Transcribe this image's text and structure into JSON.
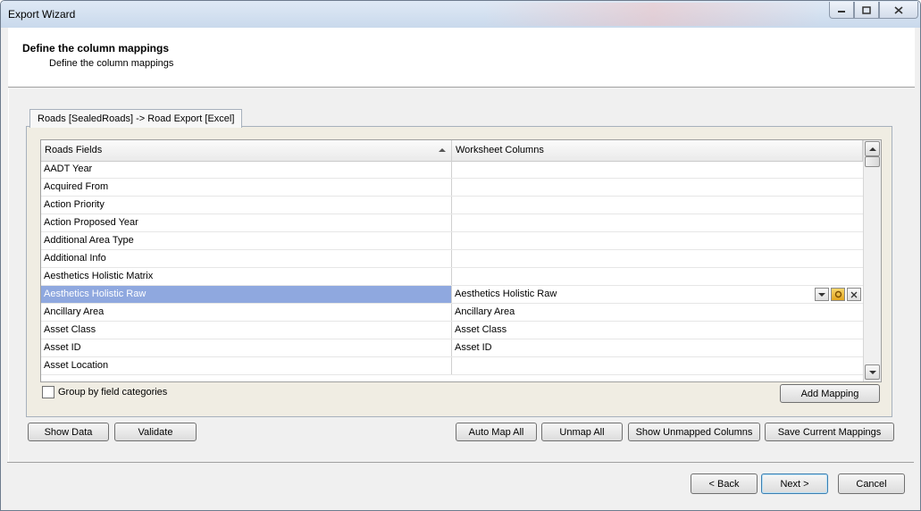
{
  "window": {
    "title": "Export Wizard",
    "controls": {
      "minimize": "—",
      "maximize": "□",
      "close": "✕"
    }
  },
  "header": {
    "title": "Define the column mappings",
    "subtitle": "Define the column mappings"
  },
  "tab": {
    "label": "Roads [SealedRoads] -> Road Export [Excel]"
  },
  "grid": {
    "columns": [
      "Roads Fields",
      "Worksheet Columns"
    ],
    "rows": [
      {
        "field": "AADT Year",
        "column": ""
      },
      {
        "field": "Acquired From",
        "column": ""
      },
      {
        "field": "Action Priority",
        "column": ""
      },
      {
        "field": "Action Proposed Year",
        "column": ""
      },
      {
        "field": "Additional Area Type",
        "column": ""
      },
      {
        "field": "Additional Info",
        "column": ""
      },
      {
        "field": "Aesthetics Holistic Matrix",
        "column": ""
      },
      {
        "field": "Aesthetics Holistic Raw",
        "column": "Aesthetics Holistic Raw"
      },
      {
        "field": "Ancillary Area",
        "column": "Ancillary Area"
      },
      {
        "field": "Asset Class",
        "column": "Asset Class"
      },
      {
        "field": "Asset ID",
        "column": "Asset ID"
      },
      {
        "field": "Asset Location",
        "column": ""
      }
    ],
    "selected_row": 7
  },
  "options": {
    "group_by_label": "Group by field categories"
  },
  "buttons": {
    "add_mapping": "Add Mapping",
    "show_data": "Show Data",
    "validate": "Validate",
    "auto_map_all": "Auto Map All",
    "unmap_all": "Unmap All",
    "show_unmapped": "Show Unmapped Columns",
    "save_mappings": "Save Current Mappings",
    "back": "< Back",
    "next": "Next >",
    "cancel": "Cancel"
  },
  "colors": {
    "selected_row": "#8fa8df",
    "titlebar": "#c9d9ec",
    "panel": "#f0ede3"
  }
}
